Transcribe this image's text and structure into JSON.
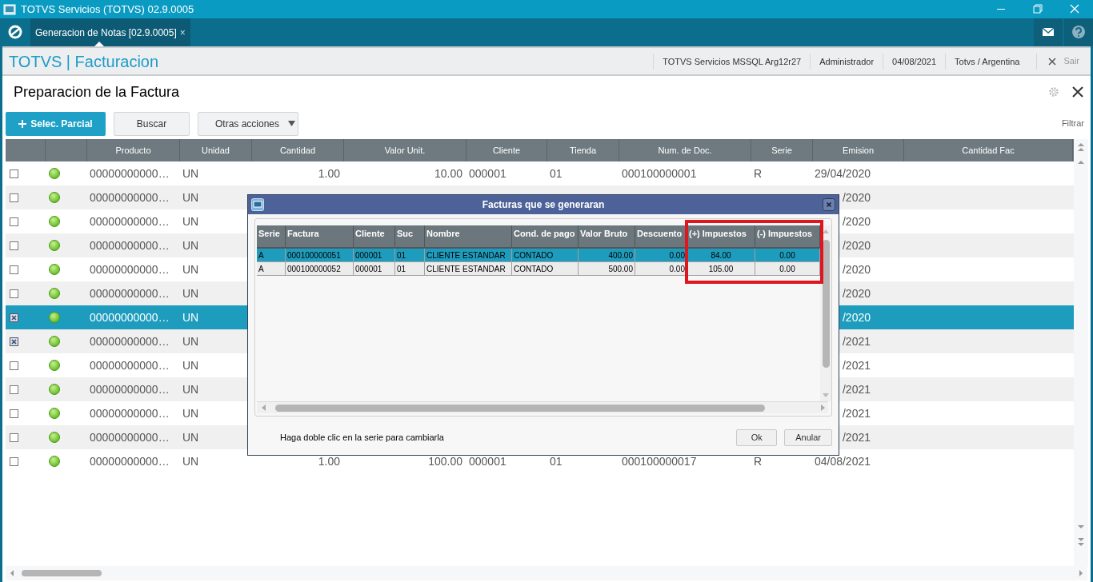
{
  "window": {
    "title": "TOTVS Servicios (TOTVS) 02.9.0005"
  },
  "tabs": [
    {
      "label": "Generacion de Notas [02.9.0005]",
      "close": "×",
      "selected": true
    }
  ],
  "app_title": "TOTVS | Facturacion",
  "header_info": [
    "TOTVS Servicios MSSQL Arg12r27",
    "Administrador",
    "04/08/2021",
    "Totvs / Argentina"
  ],
  "exit_label": "Sair",
  "page_title": "Preparacion de la Factura",
  "toolbar": {
    "primary": "Selec. Parcial",
    "search": "Buscar",
    "more": "Otras acciones",
    "filter": "Filtrar"
  },
  "grid": {
    "columns": [
      "",
      "",
      "Producto",
      "Unidad",
      "Cantidad",
      "Valor Unit.",
      "Cliente",
      "Tienda",
      "Num. de Doc.",
      "Serie",
      "Emision",
      "Cantidad Fac"
    ],
    "rows": [
      {
        "checked": false,
        "selected": false,
        "producto": "00000000000…",
        "unidad": "UN",
        "cantidad": "1.00",
        "valor": "10.00",
        "cliente": "000001",
        "tienda": "01",
        "doc": "000100000001",
        "serie": "R",
        "emision": "29/04/2020"
      },
      {
        "checked": false,
        "selected": false,
        "producto": "00000000000…",
        "unidad": "UN",
        "emision": "/2020"
      },
      {
        "checked": false,
        "selected": false,
        "producto": "00000000000…",
        "unidad": "UN",
        "emision": "/2020"
      },
      {
        "checked": false,
        "selected": false,
        "producto": "00000000000…",
        "unidad": "UN",
        "emision": "/2020"
      },
      {
        "checked": false,
        "selected": false,
        "producto": "00000000000…",
        "unidad": "UN",
        "emision": "/2020"
      },
      {
        "checked": false,
        "selected": false,
        "producto": "00000000000…",
        "unidad": "UN",
        "emision": "/2020"
      },
      {
        "checked": true,
        "selected": true,
        "producto": "00000000000…",
        "unidad": "UN",
        "emision": "/2020"
      },
      {
        "checked": true,
        "selected": false,
        "producto": "00000000000…",
        "unidad": "UN",
        "emision": "/2021"
      },
      {
        "checked": false,
        "selected": false,
        "producto": "00000000000…",
        "unidad": "UN",
        "emision": "/2021"
      },
      {
        "checked": false,
        "selected": false,
        "producto": "00000000000…",
        "unidad": "UN",
        "emision": "/2021"
      },
      {
        "checked": false,
        "selected": false,
        "producto": "00000000000…",
        "unidad": "UN",
        "emision": "/2021"
      },
      {
        "checked": false,
        "selected": false,
        "producto": "00000000000…",
        "unidad": "UN",
        "emision": "/2021"
      },
      {
        "checked": false,
        "selected": false,
        "producto": "00000000000…",
        "unidad": "UN",
        "cantidad": "1.00",
        "valor": "100.00",
        "cliente": "000001",
        "tienda": "01",
        "doc": "000100000017",
        "serie": "R",
        "emision": "04/08/2021"
      }
    ]
  },
  "dialog": {
    "title": "Facturas que se generaran",
    "columns": [
      "Serie",
      "Factura",
      "Cliente",
      "Suc",
      "Nombre",
      "Cond. de pago",
      "Valor Bruto",
      "Descuento",
      "(+) Impuestos",
      "(-) Impuestos"
    ],
    "rows": [
      {
        "selected": true,
        "cells": [
          "A",
          "000100000051",
          "000001",
          "01",
          "CLIENTE ESTANDAR",
          "CONTADO",
          "400.00",
          "0.00",
          "84.00",
          "0.00"
        ]
      },
      {
        "selected": false,
        "cells": [
          "A",
          "000100000052",
          "000001",
          "01",
          "CLIENTE ESTANDAR",
          "CONTADO",
          "500.00",
          "0.00",
          "105.00",
          "0.00"
        ]
      }
    ],
    "hint": "Haga doble clic en la serie para cambiarla",
    "buttons": [
      "Ok",
      "Anular"
    ]
  }
}
